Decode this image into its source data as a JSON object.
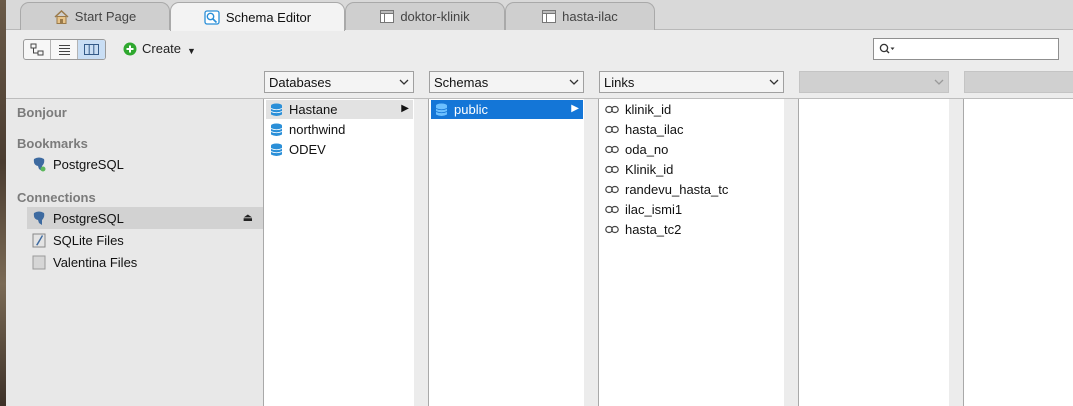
{
  "tabs": [
    {
      "label": "Start Page",
      "icon": "home-icon"
    },
    {
      "label": "Schema Editor",
      "icon": "schema-editor-icon",
      "active": true
    },
    {
      "label": "doktor-klinik",
      "icon": "table-icon"
    },
    {
      "label": "hasta-ilac",
      "icon": "table-icon"
    }
  ],
  "toolbar": {
    "create_label": "Create",
    "search_placeholder": ""
  },
  "columns": {
    "databases_label": "Databases",
    "schemas_label": "Schemas",
    "links_label": "Links",
    "col4_label": "",
    "col5_label": ""
  },
  "sidebar": {
    "bonjour_title": "Bonjour",
    "bookmarks_title": "Bookmarks",
    "bookmarks": [
      {
        "label": "PostgreSQL",
        "icon": "postgresql-icon"
      }
    ],
    "connections_title": "Connections",
    "connections": [
      {
        "label": "PostgreSQL",
        "icon": "postgresql-icon",
        "selected": true
      },
      {
        "label": "SQLite Files",
        "icon": "sqlite-icon"
      },
      {
        "label": "Valentina Files",
        "icon": "valentina-icon"
      }
    ]
  },
  "databases": [
    {
      "label": "Hastane",
      "selected": true
    },
    {
      "label": "northwind"
    },
    {
      "label": "ODEV"
    }
  ],
  "schemas": [
    {
      "label": "public",
      "selected": true
    }
  ],
  "links": [
    {
      "label": "klinik_id"
    },
    {
      "label": "hasta_ilac"
    },
    {
      "label": "oda_no"
    },
    {
      "label": "Klinik_id"
    },
    {
      "label": "randevu_hasta_tc"
    },
    {
      "label": "ilac_ismi1"
    },
    {
      "label": "hasta_tc2"
    }
  ],
  "colors": {
    "selection_blue": "#1476d7",
    "db_icon_blue": "#2a8fd8",
    "create_green": "#2fa82f"
  }
}
